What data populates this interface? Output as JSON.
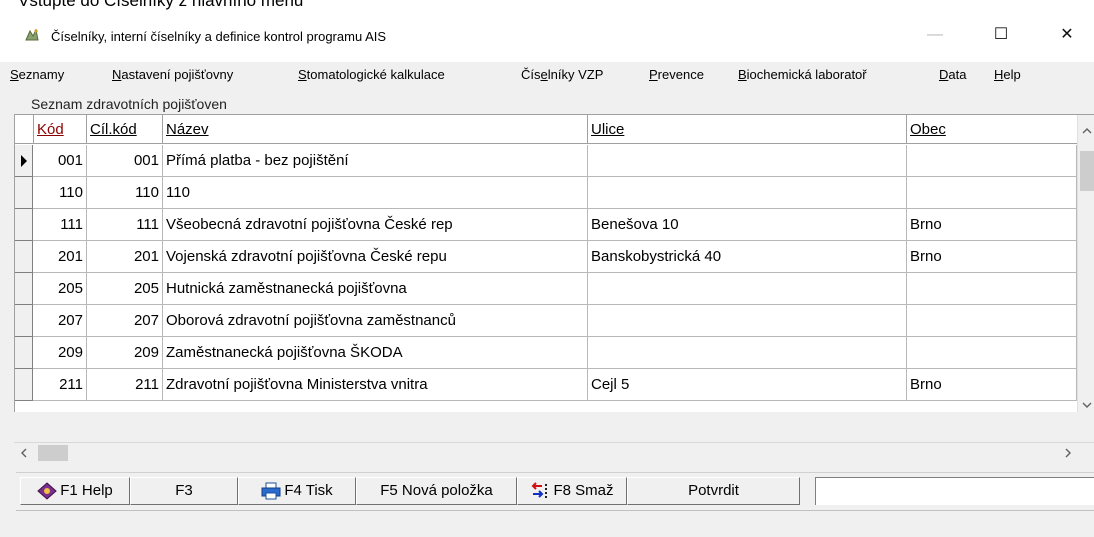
{
  "doc_caption": "Vstupte do Číselníky z hlavního menu",
  "window": {
    "title": "Číselníky, interní číselníky a definice kontrol programu AIS",
    "app_icon": "ais-app-icon",
    "controls": {
      "minimize": "—",
      "maximize": "☐",
      "close": "✕"
    }
  },
  "menu": [
    {
      "pre": "",
      "u": "S",
      "post": "eznamy"
    },
    {
      "pre": "",
      "u": "N",
      "post": "astavení pojišťovny"
    },
    {
      "pre": "",
      "u": "S",
      "post": "tomatologické kalkulace"
    },
    {
      "pre": "Čís",
      "u": "e",
      "post": "lníky VZP"
    },
    {
      "pre": "",
      "u": "P",
      "post": "revence"
    },
    {
      "pre": "",
      "u": "B",
      "post": "iochemická laboratoř"
    },
    {
      "pre": "",
      "u": "D",
      "post": "ata"
    },
    {
      "pre": "",
      "u": "H",
      "post": "elp"
    }
  ],
  "list_caption": "Seznam zdravotních pojišťoven",
  "columns": [
    "Kód",
    "Cíl.kód",
    "Název",
    "Ulice",
    "Obec"
  ],
  "accent_header_color": "#8b0000",
  "rows": [
    {
      "kod": "001",
      "cil": "001",
      "nazev": "Přímá platba - bez pojištění",
      "ulice": "",
      "obec": "",
      "current": true
    },
    {
      "kod": "110",
      "cil": "110",
      "nazev": "110",
      "ulice": "",
      "obec": ""
    },
    {
      "kod": "111",
      "cil": "111",
      "nazev": "Všeobecná zdravotní pojišťovna České rep",
      "ulice": "Benešova 10",
      "obec": "Brno"
    },
    {
      "kod": "201",
      "cil": "201",
      "nazev": "Vojenská zdravotní pojišťovna České repu",
      "ulice": " Banskobystrická 40",
      "obec": "Brno"
    },
    {
      "kod": "205",
      "cil": "205",
      "nazev": "Hutnická zaměstnanecká pojišťovna",
      "ulice": "",
      "obec": ""
    },
    {
      "kod": "207",
      "cil": "207",
      "nazev": "Oborová zdravotní pojišťovna zaměstnanců",
      "ulice": "",
      "obec": ""
    },
    {
      "kod": "209",
      "cil": "209",
      "nazev": "Zaměstnanecká pojišťovna ŠKODA",
      "ulice": "",
      "obec": ""
    },
    {
      "kod": "211",
      "cil": "211",
      "nazev": "Zdravotní pojišťovna Ministerstva vnitra",
      "ulice": "Cejl 5",
      "obec": "Brno"
    }
  ],
  "toolbar": {
    "f1": "F1 Help",
    "f3": "F3",
    "f4": "F4 Tisk",
    "f5": "F5 Nová položka",
    "f8": "F8 Smaž",
    "confirm": "Potvrdit"
  },
  "icons": {
    "row_pointer": "row-pointer-icon",
    "f1": "help-book-icon",
    "f4": "printer-icon",
    "f8": "delete-arrows-icon",
    "scroll_up": "scroll-up-icon",
    "scroll_down": "scroll-down-icon",
    "scroll_left": "scroll-left-icon",
    "scroll_right": "scroll-right-icon"
  }
}
